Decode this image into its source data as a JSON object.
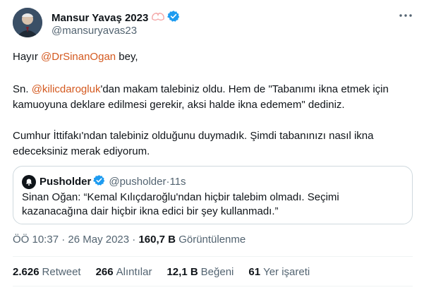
{
  "author": {
    "display_name": "Mansur Yavaş 2023",
    "handle": "@mansuryavas23"
  },
  "tweet": {
    "p1_before": "Hayır ",
    "p1_mention": "@DrSinanOgan",
    "p1_after": " bey,",
    "p2_before": "Sn. ",
    "p2_mention": "@kilicdarogluk",
    "p2_after": "'dan makam talebiniz oldu. Hem de \"Tabanımı ikna etmek için kamuoyuna deklare edilmesi gerekir, aksi halde ikna edemem\" dediniz.",
    "p3": "Cumhur İttifakı'ndan talebiniz olduğunu duymadık. Şimdi tabanınızı nasıl ikna edeceksiniz merak ediyorum."
  },
  "quote": {
    "name": "Pusholder",
    "handle": "@pusholder",
    "separator": " · ",
    "time": "11s",
    "text": "Sinan Oğan: “Kemal Kılıçdaroğlu'ndan hiçbir talebim olmadı. Seçimi kazanacağına dair hiçbir ikna edici bir şey kullanmadı.”"
  },
  "meta": {
    "time": "ÖÖ 10:37",
    "separator": " · ",
    "date": "26 May 2023",
    "views_count": "160,7 B",
    "views_label": "Görüntülenme"
  },
  "stats": [
    {
      "count": "2.626",
      "label": "Retweet"
    },
    {
      "count": "266",
      "label": "Alıntılar"
    },
    {
      "count": "12,1 B",
      "label": "Beğeni"
    },
    {
      "count": "61",
      "label": "Yer işareti"
    }
  ],
  "colors": {
    "mention": "#d4591f",
    "verified": "#1d9bf0",
    "secondary_text": "#536471"
  },
  "icons": [
    "hands-emoji-icon",
    "verified-badge-icon",
    "more-options-icon",
    "pusholder-logo-icon"
  ]
}
